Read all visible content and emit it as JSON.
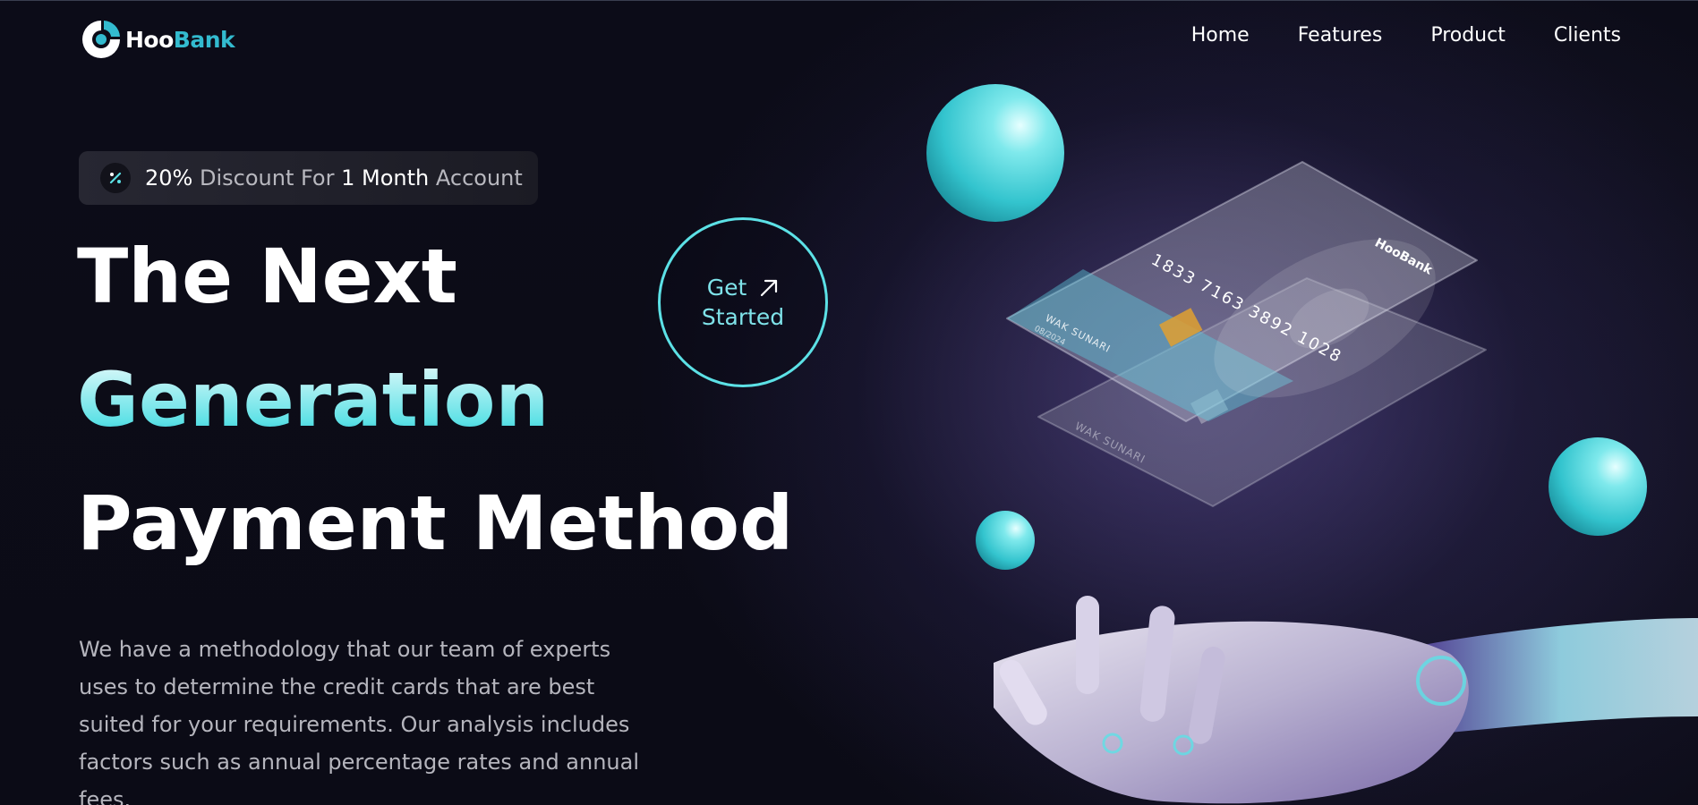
{
  "brand": {
    "logo_word_1": "Hoo",
    "logo_word_2": "Bank"
  },
  "nav": {
    "items": [
      {
        "label": "Home"
      },
      {
        "label": "Features"
      },
      {
        "label": "Product"
      },
      {
        "label": "Clients"
      }
    ]
  },
  "promo": {
    "percent": "20%",
    "word_discount": "Discount For",
    "duration": "1 Month",
    "word_account": "Account"
  },
  "hero": {
    "title_line_1": "The Next",
    "title_line_2": "Generation",
    "title_line_3": "Payment Method",
    "description": "We have a methodology that our team of experts uses to determine the credit cards that are best suited for your requirements. Our analysis includes factors such as annual percentage rates and annual fees."
  },
  "cta": {
    "line_1": "Get",
    "line_2": "Started",
    "icon": "arrow-up-right-icon"
  },
  "card": {
    "number": "1833 7163 3892 1028",
    "holder": "WAK SUNARI",
    "expiry": "08/2024",
    "brand": "HooBank"
  },
  "colors": {
    "background": "#0b0b16",
    "accent": "#5ce1e6",
    "accent_dark": "#33bbcf",
    "text_muted": "#b5b5bd"
  },
  "icons": [
    "logo-icon",
    "percent-icon",
    "arrow-up-right-icon"
  ]
}
